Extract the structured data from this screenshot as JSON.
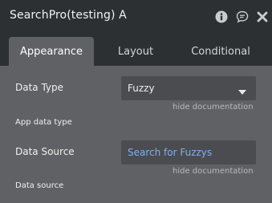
{
  "window": {
    "title": "SearchPro(testing) A"
  },
  "tabs": [
    {
      "label": "Appearance",
      "active": true
    },
    {
      "label": "Layout",
      "active": false
    },
    {
      "label": "Conditional",
      "active": false
    }
  ],
  "fields": {
    "data_type": {
      "label": "Data Type",
      "value": "Fuzzy",
      "doc_link": "hide documentation",
      "doc_text": "App data type"
    },
    "data_source": {
      "label": "Data Source",
      "value": "Search for Fuzzys",
      "doc_link": "hide documentation",
      "doc_text": "Data source"
    }
  },
  "icons": {
    "info": "info-icon",
    "comment": "comment-icon",
    "close": "close-icon",
    "dropdown": "chevron-down-icon"
  },
  "colors": {
    "link_blue": "#7fb0f0",
    "panel_bg": "#5f6164",
    "header_bg": "#2d3033",
    "field_bg": "#4a4c50"
  }
}
